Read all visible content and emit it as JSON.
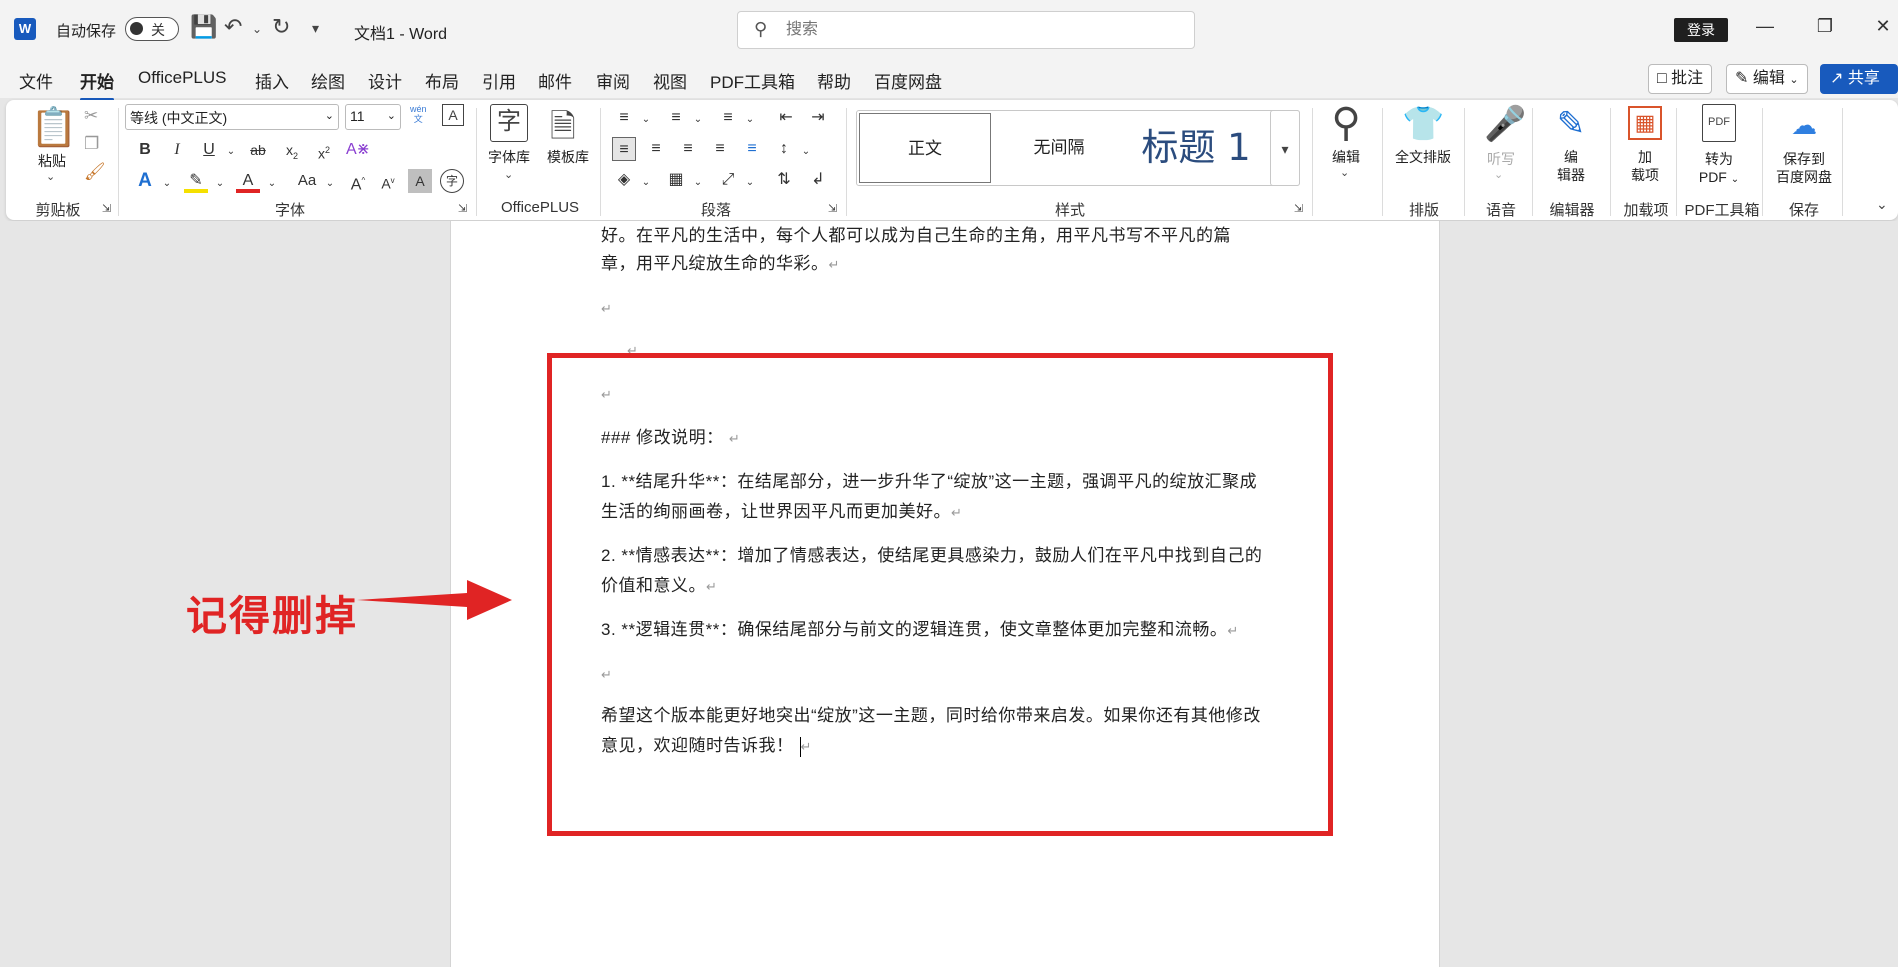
{
  "titlebar": {
    "autosave_label": "自动保存",
    "autosave_state": "关",
    "doc_title": "文档1  -  Word",
    "search_placeholder": "搜索",
    "login_label": "登录"
  },
  "menu": {
    "tabs": [
      "文件",
      "开始",
      "OfficePLUS",
      "插入",
      "绘图",
      "设计",
      "布局",
      "引用",
      "邮件",
      "审阅",
      "视图",
      "PDF工具箱",
      "帮助",
      "百度网盘"
    ],
    "active": "开始",
    "comment_label": "批注",
    "edit_label": "编辑",
    "share_label": "共享"
  },
  "ribbon": {
    "clipboard": {
      "paste": "粘贴",
      "group": "剪贴板"
    },
    "font": {
      "name": "等线 (中文正文)",
      "size": "11",
      "group": "字体",
      "pinyin": "wén"
    },
    "officeplus": {
      "font_lib": "字体库",
      "template_lib": "模板库",
      "group": "OfficePLUS"
    },
    "paragraph": {
      "group": "段落"
    },
    "styles": {
      "items": [
        "正文",
        "无间隔",
        "标题 1"
      ],
      "group": "样式"
    },
    "editing": {
      "label": "编辑"
    },
    "layout": {
      "label": "全文排版",
      "group": "排版"
    },
    "voice": {
      "label": "听写",
      "group": "语音"
    },
    "editor": {
      "label1": "编",
      "label2": "辑器",
      "group": "编辑器"
    },
    "addins": {
      "label1": "加",
      "label2": "载项",
      "group": "加载项"
    },
    "pdf": {
      "label1": "转为",
      "label2": "PDF",
      "group": "PDF工具箱"
    },
    "baidu": {
      "label1": "保存到",
      "label2": "百度网盘",
      "group": "保存"
    }
  },
  "document": {
    "line1": "好。在平凡的生活中，每个人都可以成为自己生命的主角，用平凡书写不平凡的篇",
    "line2": "章，用平凡绽放生命的华彩。",
    "heading": "### 修改说明：",
    "item1_l1": "1. **结尾升华**：在结尾部分，进一步升华了“绽放”这一主题，强调平凡的绽放汇聚成",
    "item1_l2": "生活的绚丽画卷，让世界因平凡而更加美好。",
    "item2_l1": "2. **情感表达**：增加了情感表达，使结尾更具感染力，鼓励人们在平凡中找到自己的",
    "item2_l2": "价值和意义。",
    "item3": "3. **逻辑连贯**：确保结尾部分与前文的逻辑连贯，使文章整体更加完整和流畅。",
    "closing_l1": "希望这个版本能更好地突出“绽放”这一主题，同时给你带来启发。如果你还有其他修改",
    "closing_l2": "意见，欢迎随时告诉我！",
    "para_mark": "↵"
  },
  "annotation": {
    "text": "记得删掉",
    "color": "#e02424"
  },
  "colors": {
    "accent": "#185abd",
    "annotation": "#e02424"
  }
}
